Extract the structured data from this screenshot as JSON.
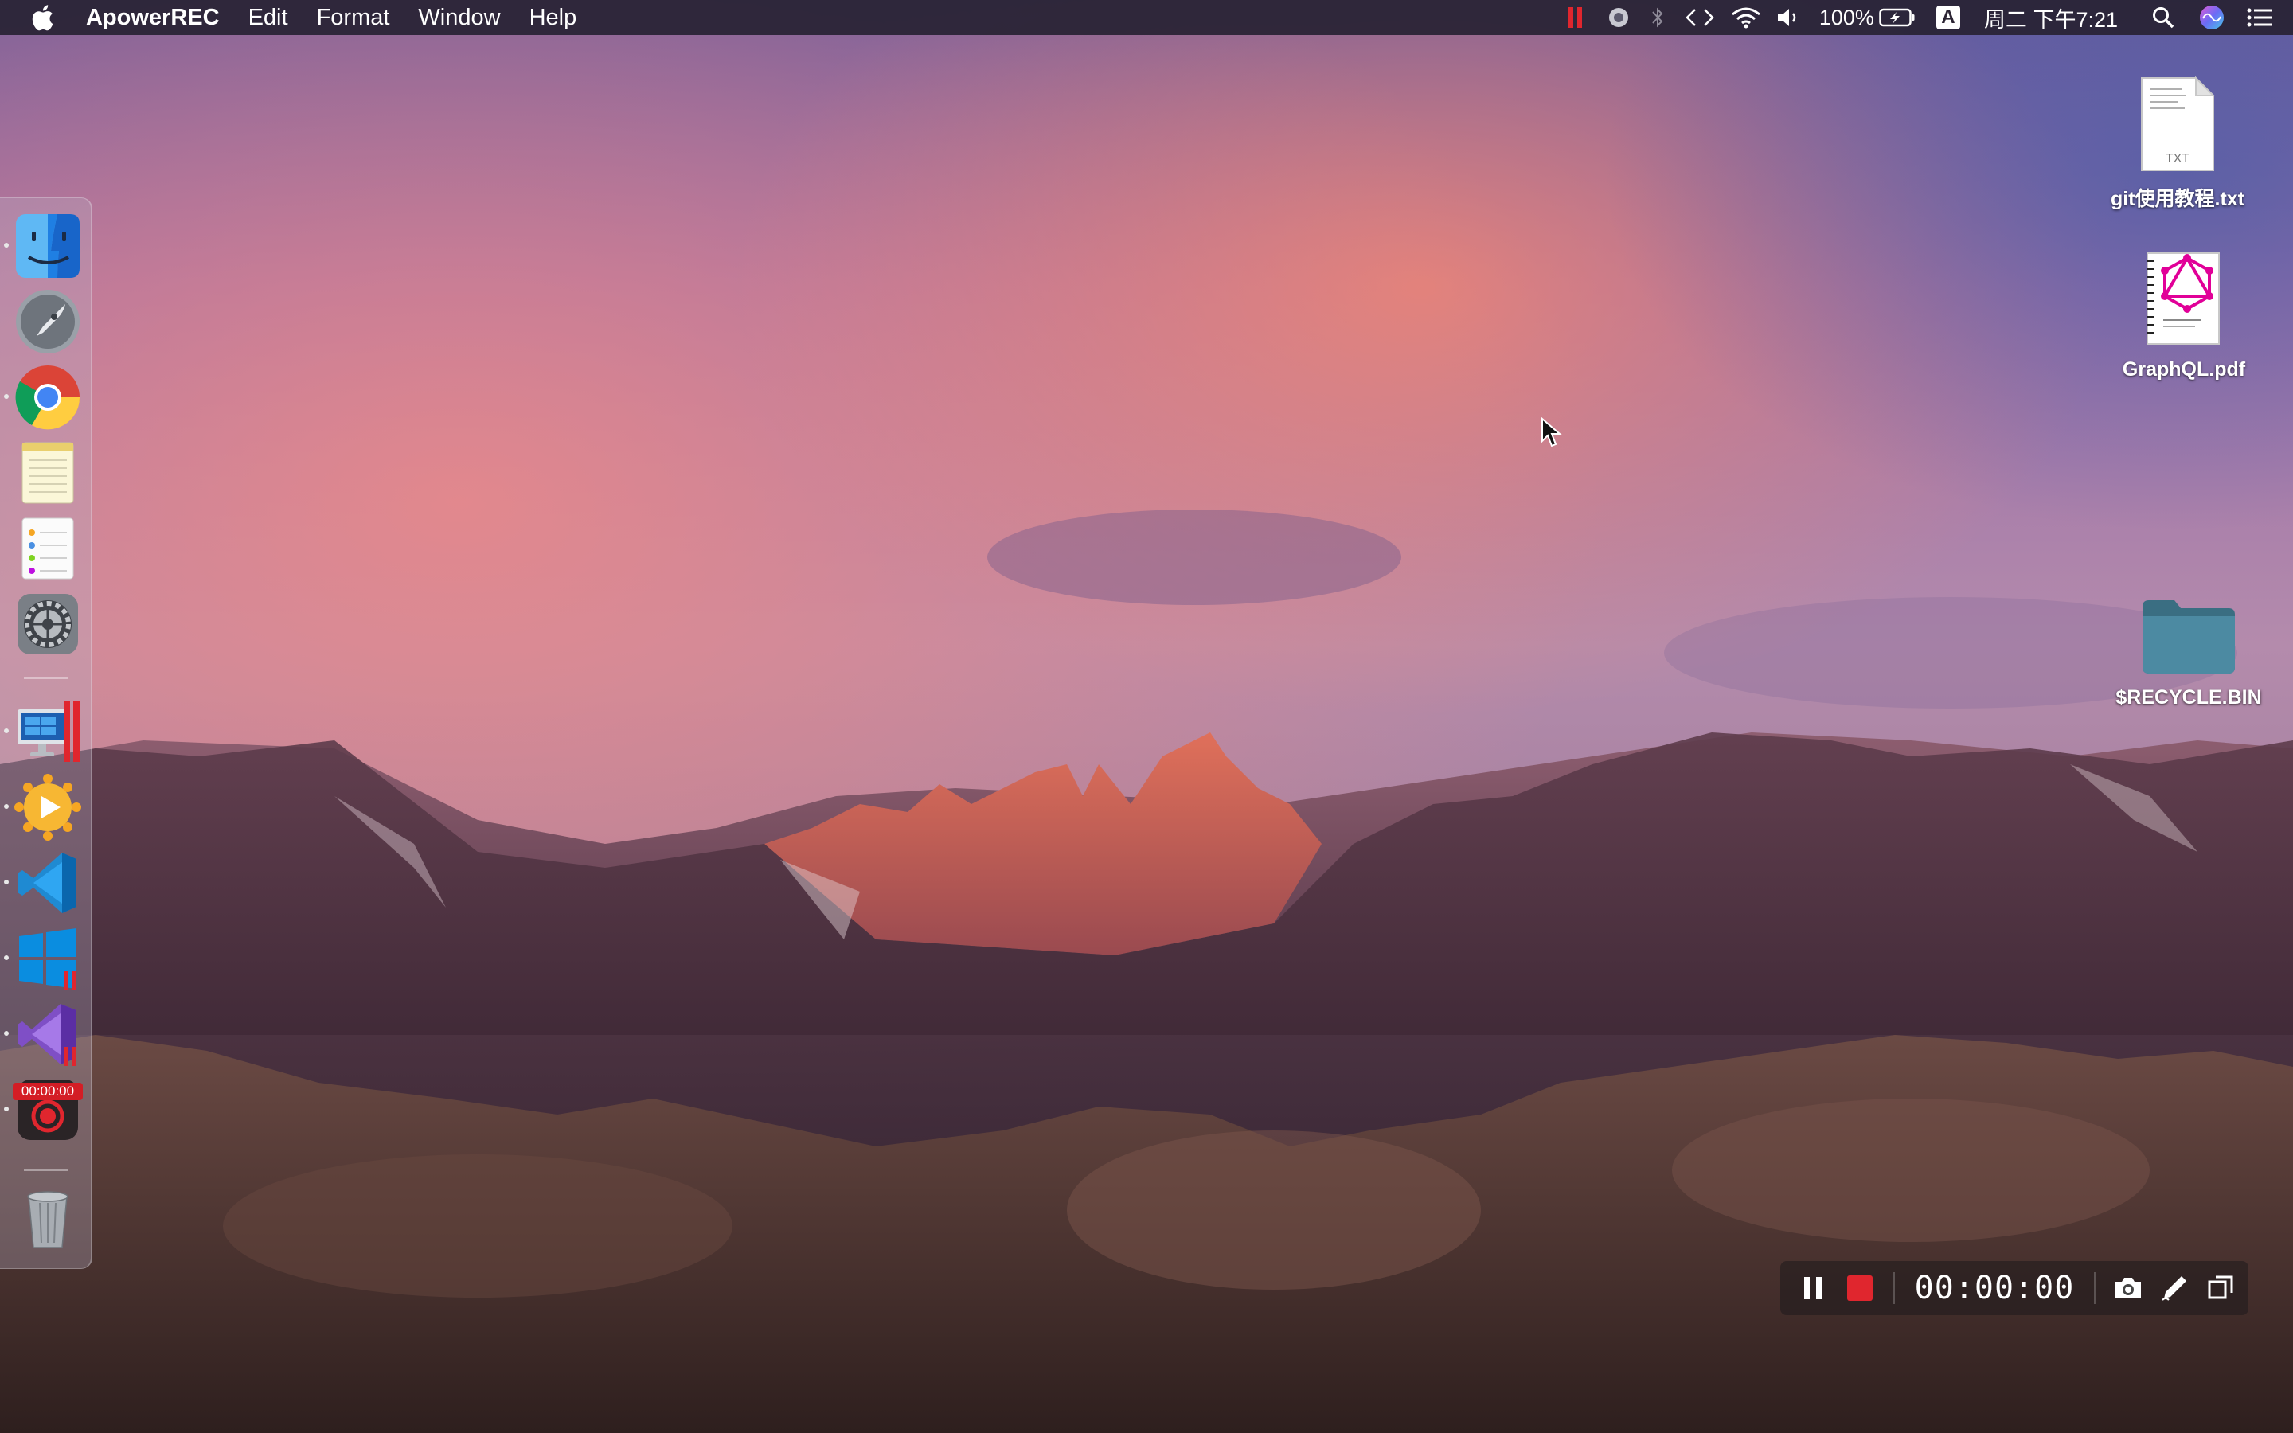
{
  "menubar": {
    "app_name": "ApowerREC",
    "items": [
      "Edit",
      "Format",
      "Window",
      "Help"
    ],
    "status": {
      "battery_percent": "100%",
      "input_method": "A",
      "datetime": "周二 下午7:21"
    }
  },
  "desktop": {
    "icons": [
      {
        "label": "git使用教程.txt",
        "file_type": "TXT"
      },
      {
        "label": "GraphQL.pdf"
      },
      {
        "label": "$RECYCLE.BIN"
      }
    ]
  },
  "dock": {
    "recorder_timer": "00:00:00"
  },
  "recorder": {
    "time": "00:00:00"
  },
  "colors": {
    "menubar_bg": "#2b2433",
    "record_red": "#e0262e"
  }
}
